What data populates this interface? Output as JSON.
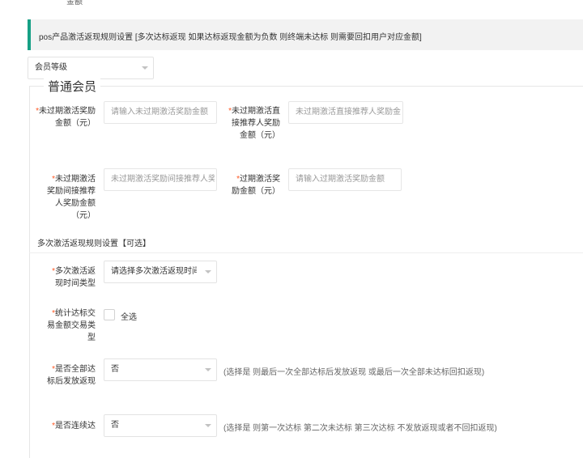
{
  "header_fragment": "金额",
  "banner": {
    "text": "pos产品激活返现规则设置 [多次达标返现 如果达标返现金额为负数 则终端未达标 则需要回扣用户对应金额]"
  },
  "member_level_select": {
    "value": "会员等级"
  },
  "group": {
    "legend": "普通会员"
  },
  "fields": {
    "unexpired_reward": {
      "req": "*",
      "label": "未过期激活奖励金额（元）",
      "placeholder": "请输入未过期激活奖励金额"
    },
    "unexpired_direct_referrer": {
      "req": "*",
      "label": "未过期激活直接推荐人奖励金额（元）",
      "placeholder": "未过期激活直接推荐人奖励金额"
    },
    "unexpired_indirect_referrer": {
      "req": "*",
      "label": "未过期激活奖励间接推荐人奖励金额（元）",
      "placeholder": "未过期激活奖励间接推荐人奖励金额"
    },
    "expired_reward": {
      "req": "*",
      "label": "过期激活奖励金额（元）",
      "placeholder": "请输入过期激活奖励金额"
    }
  },
  "multi_section": {
    "title": "多次激活返现规则设置【可选】"
  },
  "multi_fields": {
    "time_type": {
      "req": "*",
      "label": "多次激活返现时间类型",
      "value": "请选择多次激活返现时间"
    },
    "stat_type": {
      "req": "*",
      "label": "统计达标交易金额交易类型",
      "checkbox_label": "全选"
    },
    "all_reached": {
      "req": "*",
      "label": "是否全部达标后发放返现",
      "value": "否",
      "hint": "(选择是 则最后一次全部达标后发放返现 或最后一次全部未达标回扣返现)"
    },
    "consecutive": {
      "req": "*",
      "label": "是否连续达",
      "value": "否",
      "hint": "(选择是 则第一次达标 第二次未达标 第三次达标 不发放返现或者不回扣返现)"
    }
  }
}
